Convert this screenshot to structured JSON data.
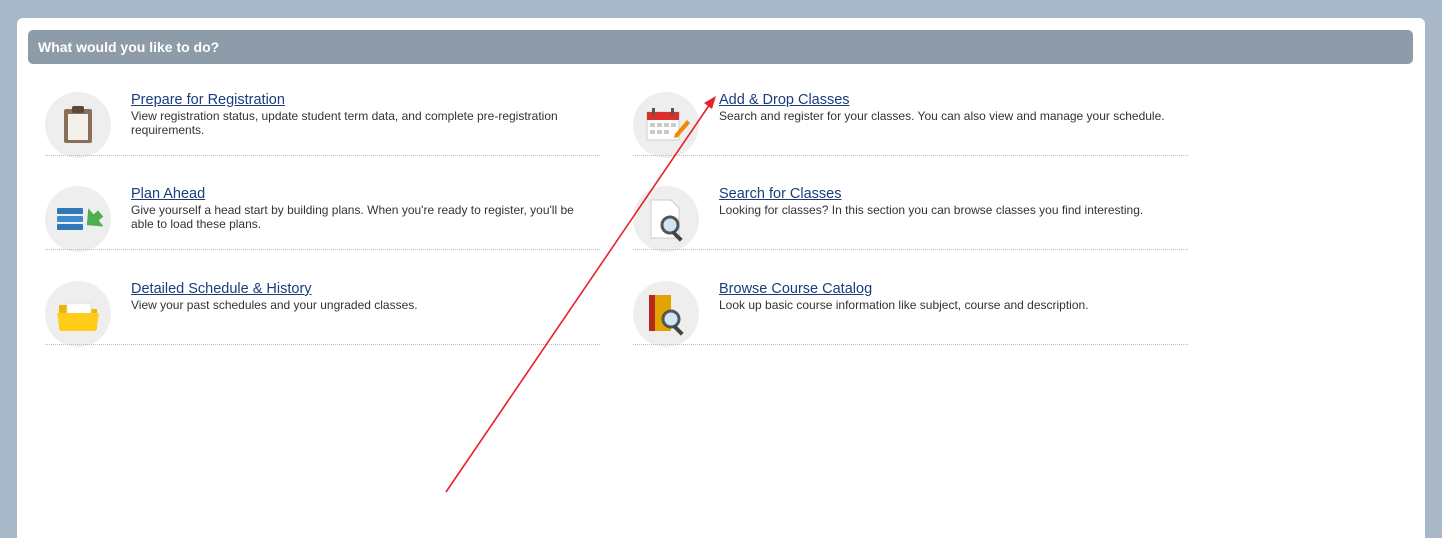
{
  "header": {
    "title": "What would you like to do?"
  },
  "items": [
    {
      "title": "Prepare for Registration",
      "description": "View registration status, update student term data, and complete pre-registration requirements."
    },
    {
      "title": "Plan Ahead",
      "description": "Give yourself a head start by building plans. When you're ready to register, you'll be able to load these plans."
    },
    {
      "title": "Detailed Schedule & History",
      "description": "View your past schedules and your ungraded classes."
    },
    {
      "title": "Add & Drop Classes",
      "description": "Search and register for your classes. You can also view and manage your schedule."
    },
    {
      "title": "Search for Classes",
      "description": "Looking for classes? In this section you can browse classes you find interesting."
    },
    {
      "title": "Browse Course Catalog",
      "description": "Look up basic course information like subject, course and description."
    }
  ],
  "icons": [
    "clipboard-icon",
    "plan-list-icon",
    "folder-icon",
    "calendar-edit-icon",
    "document-search-icon",
    "book-search-icon"
  ],
  "colors": {
    "background": "#a9b8c8",
    "header": "#8e9ba8",
    "link": "#1a3d7a",
    "annotation_arrow": "#e8202a"
  }
}
